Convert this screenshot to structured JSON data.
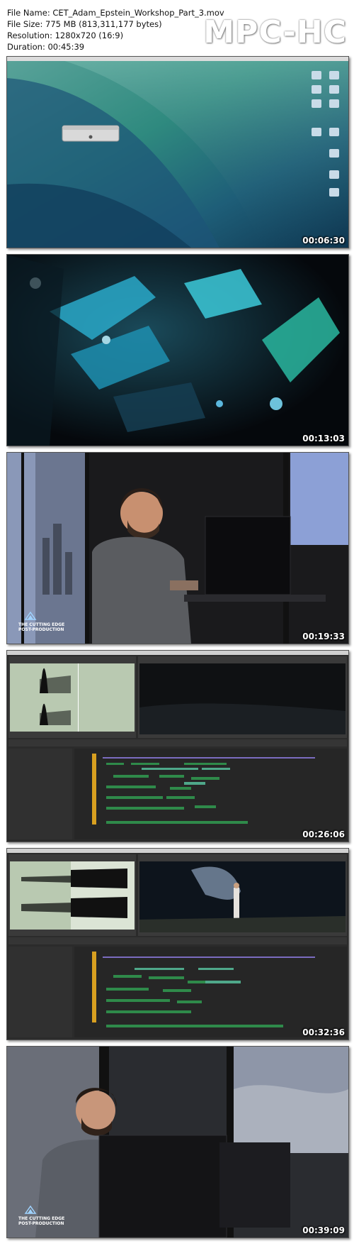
{
  "header": {
    "file_name": "File Name: CET_Adam_Epstein_Workshop_Part_3.mov",
    "file_size": "File Size: 775 MB (813,311,177 bytes)",
    "resolution": "Resolution: 1280x720 (16:9)",
    "duration": "Duration: 00:45:39",
    "logo": "MPC-HC"
  },
  "thumbnails": [
    {
      "timestamp": "00:06:30",
      "scene": "mac-desktop-wave"
    },
    {
      "timestamp": "00:13:03",
      "scene": "blurry-robot-blue-lights"
    },
    {
      "timestamp": "00:19:33",
      "scene": "man-at-computer"
    },
    {
      "timestamp": "00:26:06",
      "scene": "premiere-timeline"
    },
    {
      "timestamp": "00:32:36",
      "scene": "premiere-timeline-character"
    },
    {
      "timestamp": "00:39:09",
      "scene": "man-speaking"
    }
  ],
  "watermark": {
    "line1": "THE CUTTING EDGE",
    "line2": "POST-PRODUCTION"
  },
  "colors": {
    "clip_green": "#2f8a4a",
    "clip_teal": "#4fa88a",
    "waveform_bg": "#b8c8b0"
  }
}
